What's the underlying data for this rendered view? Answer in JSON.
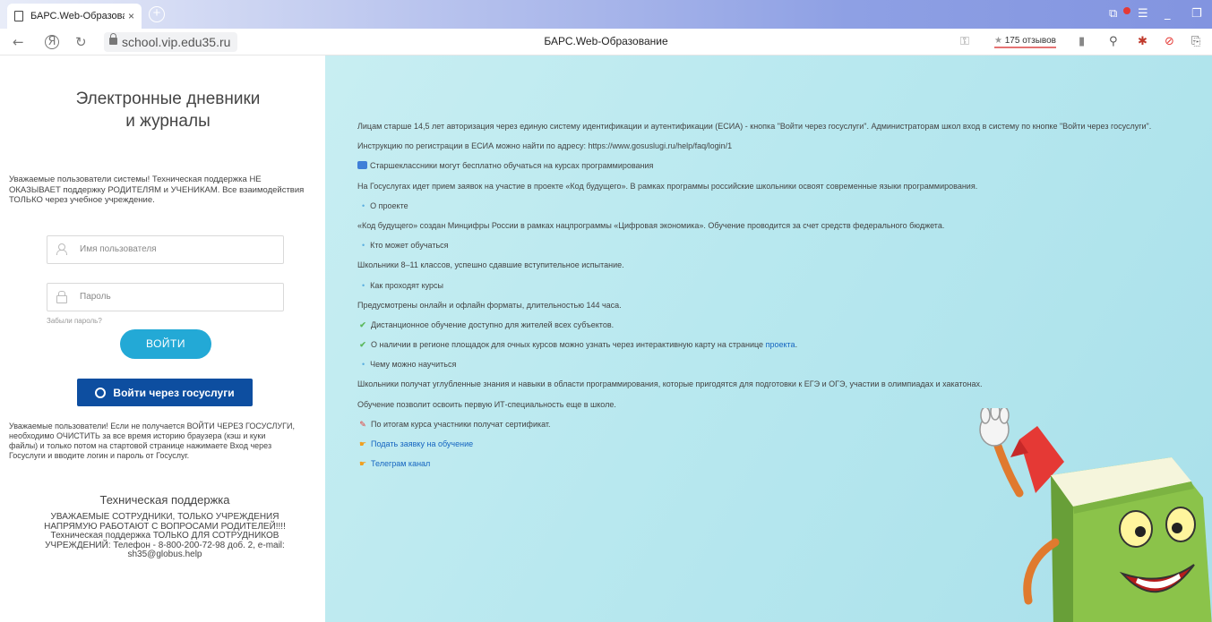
{
  "browser": {
    "tab_title": "БАРС.Web-Образован",
    "tab_close": "×",
    "new_tab": "+",
    "url": "school.vip.edu35.ru",
    "page_title": "БАРС.Web-Образование",
    "reviews_star": "★",
    "reviews": "175 отзывов"
  },
  "login": {
    "brand_line1": "Электронные дневники",
    "brand_line2": "и журналы",
    "notice1": "Уважаемые пользователи системы! Техническая поддержка НЕ ОКАЗЫВАЕТ поддержку РОДИТЕЛЯМ и УЧЕНИКАМ. Все взаимодействия ТОЛЬКО через учебное учреждение.",
    "username_placeholder": "Имя пользователя",
    "password_placeholder": "Пароль",
    "forgot": "Забыли пароль?",
    "login_button": "ВОЙТИ",
    "gosuslugi_button": "Войти через госуслуги",
    "notice2": "Уважаемые пользователи! Если не получается ВОЙТИ ЧЕРЕЗ ГОСУСЛУГИ, необходимо ОЧИСТИТЬ за все время историю браузера (кэш и куки файлы) и только потом на стартовой странице нажимаете Вход через Госуслуги и вводите логин и пароль от Госуслуг.",
    "support_title": "Техническая поддержка",
    "support_text": "УВАЖАЕМЫЕ СОТРУДНИКИ, ТОЛЬКО УЧРЕЖДЕНИЯ НАПРЯМУЮ РАБОТАЮТ С ВОПРОСАМИ РОДИТЕЛЕЙ!!!! Техническая поддержка ТОЛЬКО ДЛЯ СОТРУДНИКОВ УЧРЕЖДЕНИЙ: Телефон - 8-800-200-72-98 доб. 2, e-mail: sh35@globus.help"
  },
  "info": {
    "l1": "Лицам старше 14,5 лет авторизация через единую систему идентификации и аутентификации (ЕСИА) - кнопка \"Войти через госуслуги\". Администраторам школ вход в систему по кнопке \"Войти через госуслуги\".",
    "l2": "Инструкцию по регистрации в ЕСИА можно найти по адресу: https://www.gosuslugi.ru/help/faq/login/1",
    "l3": "Старшеклассники могут бесплатно обучаться на курсах программирования",
    "l4": "На Госуслугах идет прием заявок на участие в проекте «Код будущего». В рамках программы российские школьники освоят современные языки программирования.",
    "b1": "О проекте",
    "l5": "«Код будущего» создан Минцифры России в рамках нацпрограммы «Цифровая экономика». Обучение проводится за счет средств федерального бюджета.",
    "b2": "Кто может обучаться",
    "l6": "Школьники 8–11 классов, успешно сдавшие вступительное испытание.",
    "b3": "Как проходят курсы",
    "l7": "Предусмотрены онлайн и офлайн форматы, длительностью 144 часа.",
    "l8": "Дистанционное обучение доступно для жителей всех субъектов.",
    "l9": "О наличии в регионе площадок для очных курсов можно узнать через интерактивную карту на странице",
    "l9_link": "проекта",
    "l9_end": ".",
    "b4": "Чему можно научиться",
    "l10": "Школьники получат углубленные знания и навыки в области программирования, которые пригодятся для подготовки к ЕГЭ и ОГЭ, участии в олимпиадах и хакатонах.",
    "l11": "Обучение позволит освоить первую ИТ-специальность еще в школе.",
    "l12": "По итогам курса участники получат сертификат.",
    "link_apply": "Подать заявку на обучение",
    "link_telegram": "Телеграм канал"
  },
  "colors": {
    "accent_button": "#23a9d6",
    "gosuslugi_button": "#0d4ea0",
    "panel_bg": "#b8e8ef",
    "link": "#1565c0"
  }
}
